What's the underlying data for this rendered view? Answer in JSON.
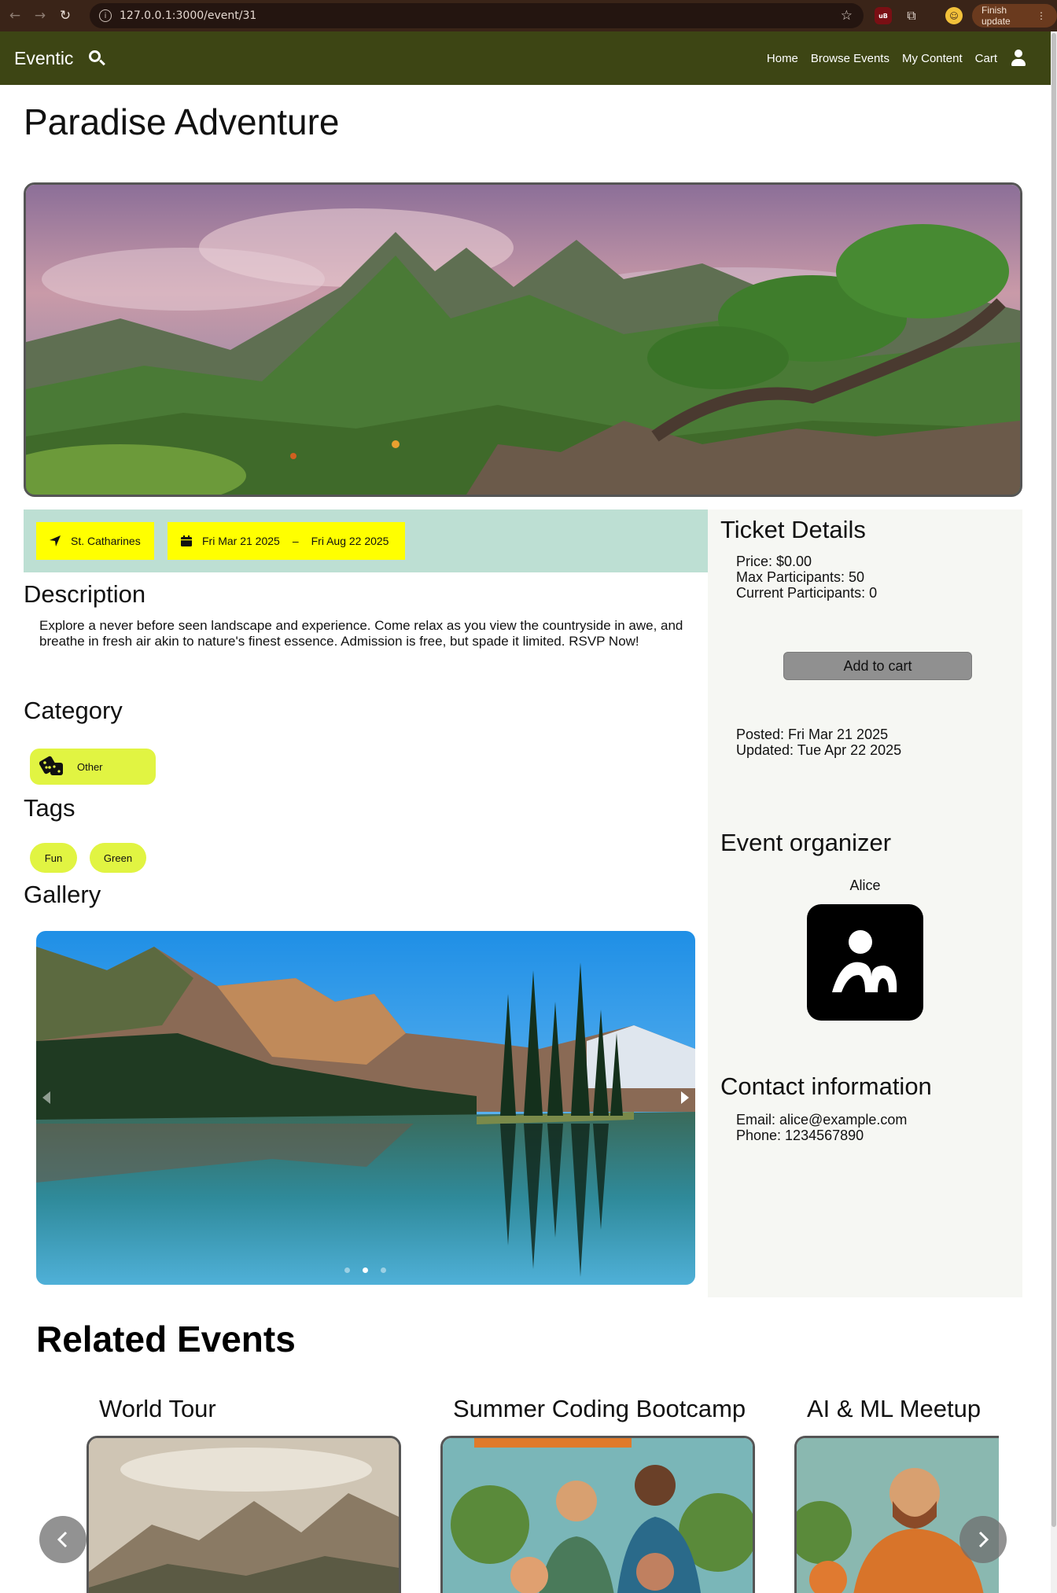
{
  "browser": {
    "url": "127.0.0.1:3000/event/31",
    "finish_update": "Finish update",
    "ext_ub": "uB"
  },
  "navbar": {
    "brand": "Eventic",
    "links": [
      "Home",
      "Browse Events",
      "My Content",
      "Cart"
    ]
  },
  "event": {
    "title": "Paradise Adventure",
    "location": "St. Catharines",
    "start_date": "Fri Mar 21 2025",
    "date_separator": "–",
    "end_date": "Fri Aug 22 2025",
    "description_heading": "Description",
    "description": "Explore a never before seen landscape and experience. Come relax as you view the countryside in awe, and breathe in fresh air akin to nature's finest essence. Admission is free, but spade it limited. RSVP Now!",
    "category_heading": "Category",
    "category": "Other",
    "tags_heading": "Tags",
    "tags": [
      "Fun",
      "Green"
    ],
    "gallery_heading": "Gallery",
    "gallery_slide_count": 3,
    "gallery_active_slide": 1
  },
  "ticket": {
    "heading": "Ticket Details",
    "price": "Price: $0.00",
    "max": "Max Participants: 50",
    "current": "Current Participants: 0",
    "add_to_cart": "Add to cart",
    "posted": "Posted: Fri Mar 21 2025",
    "updated": "Updated: Tue Apr 22 2025"
  },
  "organizer": {
    "heading": "Event organizer",
    "name": "Alice"
  },
  "contact": {
    "heading": "Contact information",
    "email": "Email: alice@example.com",
    "phone": "Phone: 1234567890"
  },
  "related": {
    "heading": "Related Events",
    "events": [
      "World Tour",
      "Summer Coding Bootcamp",
      "AI & ML Meetup"
    ]
  },
  "colors": {
    "navbar": "#3d4514",
    "chip_yellow": "#ffff00",
    "pill_lime": "#e1f442",
    "meta_strip": "#bddfd3"
  }
}
